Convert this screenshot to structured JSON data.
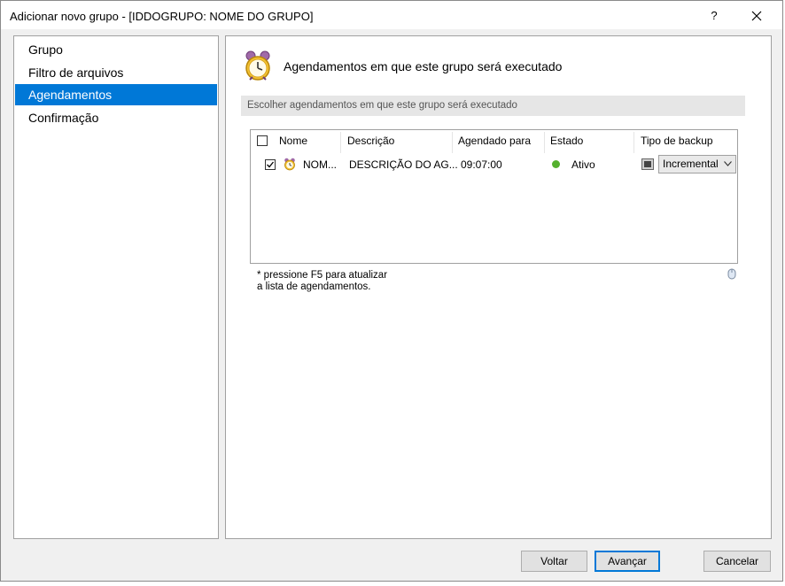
{
  "window": {
    "title": "Adicionar novo grupo - [IDDOGRUPO: NOME DO GRUPO]",
    "help_label": "?"
  },
  "sidebar": {
    "items": [
      {
        "label": "Grupo"
      },
      {
        "label": "Filtro de arquivos"
      },
      {
        "label": "Agendamentos"
      },
      {
        "label": "Confirmação"
      }
    ],
    "selected": "Agendamentos",
    "selected_color": "#0078d7"
  },
  "main": {
    "header_icon": "alarm-clock-icon",
    "title": "Agendamentos em que este grupo será executado",
    "section_title": "Escolher agendamentos em que este grupo será executado",
    "table": {
      "columns": [
        "Nome",
        "Descrição",
        "Agendado para",
        "Estado",
        "Tipo de backup"
      ],
      "rows": [
        {
          "checked": true,
          "icon": "alarm-clock-icon",
          "name": "NOM...",
          "description": "DESCRIÇÃO DO AG...",
          "scheduled_for": "09:07:00",
          "status": "Ativo",
          "status_color": "#55b02e",
          "backup_type": "Incremental"
        }
      ]
    },
    "hint_line1": "* pressione F5 para atualizar",
    "hint_line2": "a lista de agendamentos."
  },
  "footer": {
    "back_label": "Voltar",
    "next_label": "Avançar",
    "cancel_label": "Cancelar"
  }
}
